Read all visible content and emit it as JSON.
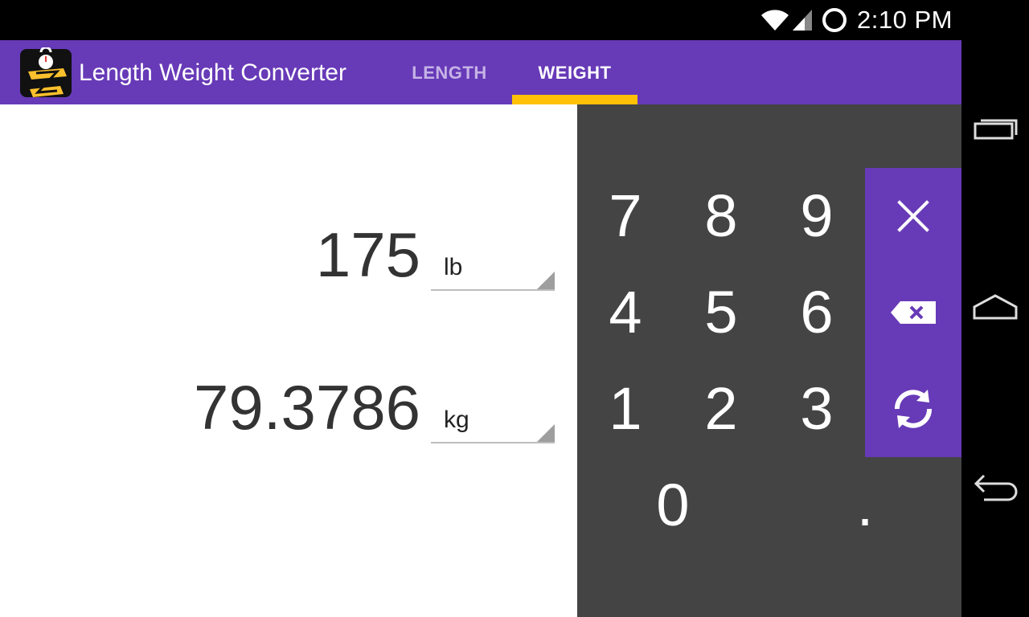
{
  "status_bar": {
    "time": "2:10 PM",
    "icons": [
      "wifi-icon",
      "signal-icon",
      "circle-icon"
    ]
  },
  "app_bar": {
    "title": "Length Weight Converter",
    "icon": "app-logo-icon",
    "color": "#673ab7",
    "tabs": [
      {
        "label": "LENGTH",
        "selected": false
      },
      {
        "label": "WEIGHT",
        "selected": true
      }
    ],
    "indicator_color": "#ffc107"
  },
  "converter": {
    "input": {
      "value": "175",
      "unit": "lb"
    },
    "output": {
      "value": "79.3786",
      "unit": "kg"
    }
  },
  "keypad": {
    "keys": [
      "7",
      "8",
      "9",
      "4",
      "5",
      "6",
      "1",
      "2",
      "3",
      "0",
      "."
    ],
    "functions": [
      "clear-icon",
      "backspace-icon",
      "swap-icon"
    ],
    "background": "#444444"
  },
  "nav_bar": {
    "buttons": [
      "recent-apps-icon",
      "home-icon",
      "back-icon"
    ]
  }
}
